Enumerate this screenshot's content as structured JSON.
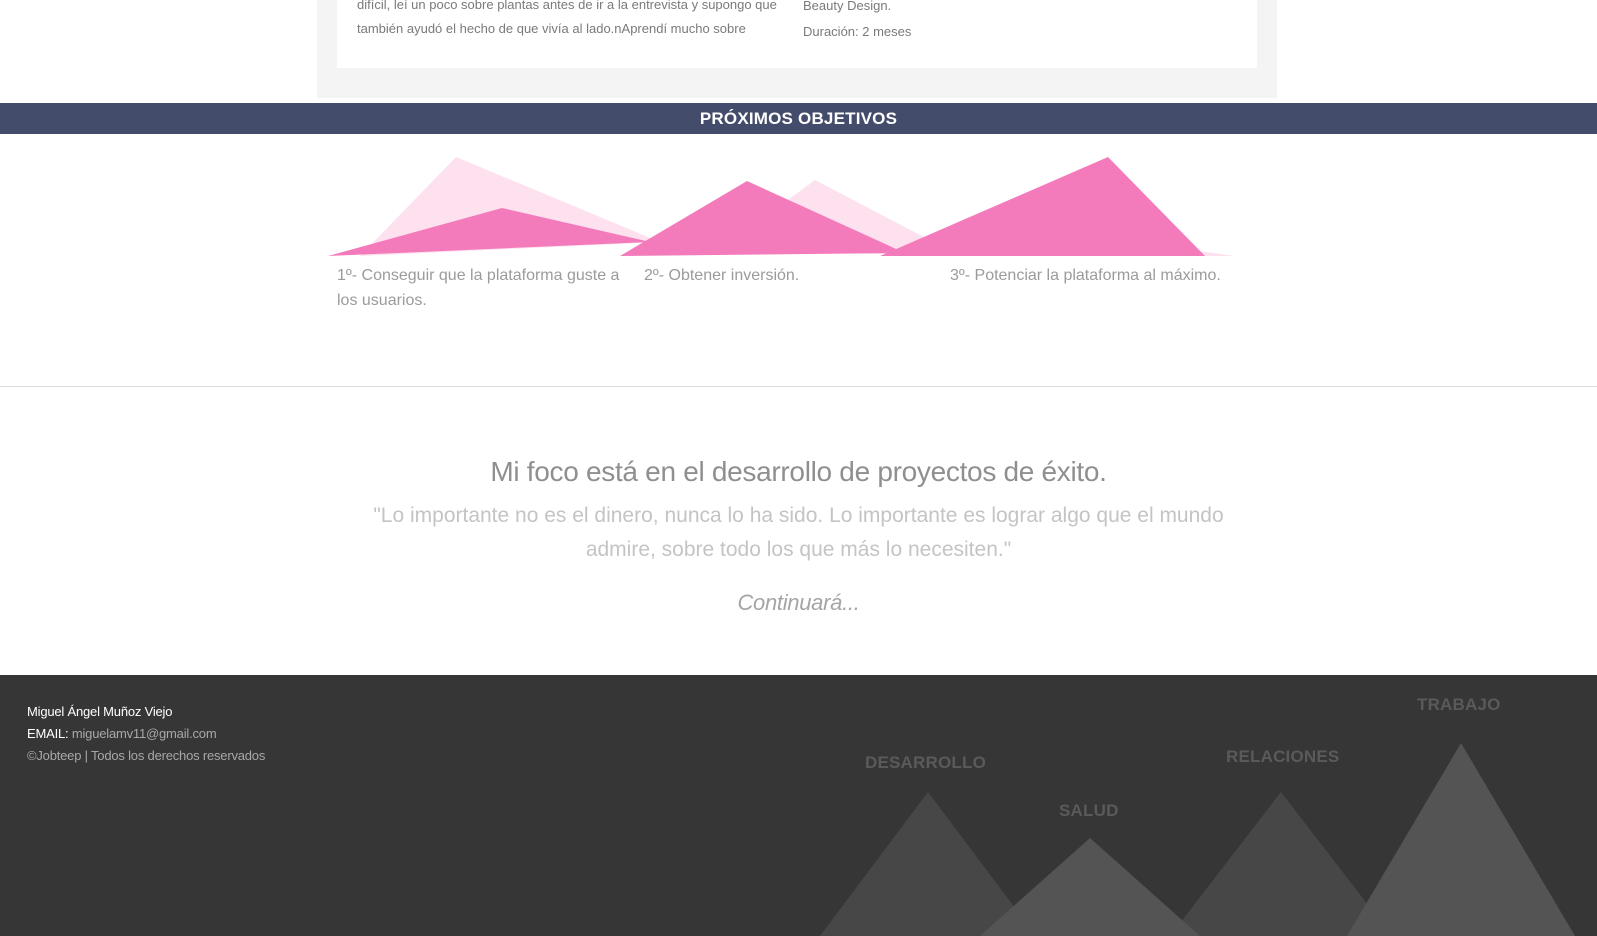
{
  "experience": {
    "text_line1": "difícil, leí un poco sobre plantas antes de ir a la entrevista y supongo que",
    "text_line2": "también ayudó el hecho de que vivía al lado.nAprendí mucho sobre",
    "company": "Beauty Design.",
    "duration": "Duración: 2 meses"
  },
  "objectives": {
    "title": "PRÓXIMOS OBJETIVOS",
    "goals": [
      "1º- Conseguir que la plataforma guste a los usuarios.",
      "2º- Obtener inversión.",
      "3º- Potenciar la plataforma al máximo."
    ],
    "colors": {
      "band": "#444c6b",
      "mountain_strong": "#f47bbb",
      "mountain_light": "#fde1ef"
    }
  },
  "focus": {
    "title": "Mi foco está en el desarrollo de proyectos de éxito.",
    "quote": "\"Lo importante no es el dinero, nunca lo ha sido. Lo importante es lograr algo que el mundo admire, sobre todo los que más lo necesiten.\"",
    "continue": "Continuará..."
  },
  "footer": {
    "name": "Miguel Ángel Muñoz Viejo",
    "email_label": "EMAIL:",
    "email": "miguelamv11@gmail.com",
    "copyright": "©Jobteep | Todos los derechos reservados",
    "mountains": [
      "DESARROLLO",
      "SALUD",
      "RELACIONES",
      "TRABAJO"
    ],
    "colors": {
      "background": "#363636",
      "mountain": "#4a4a4a"
    }
  }
}
